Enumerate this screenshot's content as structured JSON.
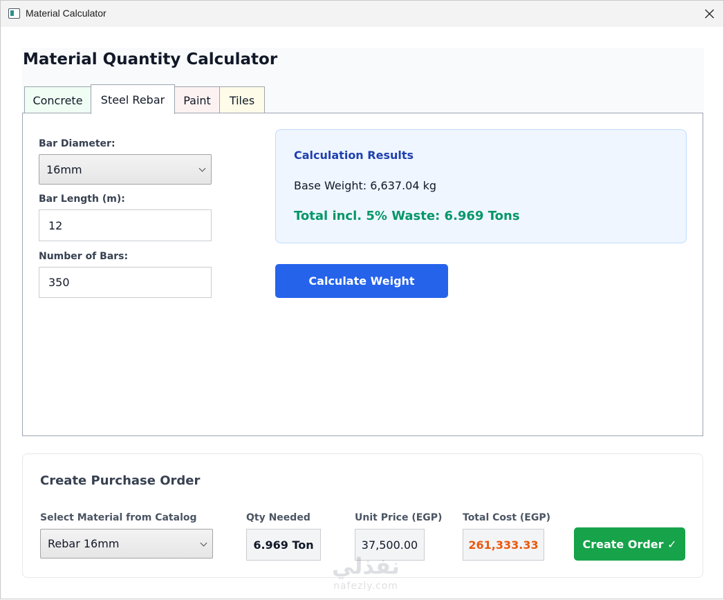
{
  "window": {
    "title": "Material Calculator",
    "app_icon": "app-window-icon",
    "close_icon": "close-icon"
  },
  "page": {
    "title": "Material Quantity Calculator"
  },
  "tabs": [
    {
      "label": "Concrete",
      "color": "#f0fdf4",
      "active": false
    },
    {
      "label": "Steel Rebar",
      "color": "#ffffff",
      "active": true
    },
    {
      "label": "Paint",
      "color": "#fdf2f2",
      "active": false
    },
    {
      "label": "Tiles",
      "color": "#fefce8",
      "active": false
    }
  ],
  "steel_rebar": {
    "diameter_label": "Bar Diameter:",
    "diameter_value": "16mm",
    "length_label": "Bar Length (m):",
    "length_value": "12",
    "count_label": "Number of Bars:",
    "count_value": "350",
    "results": {
      "title": "Calculation Results",
      "base_weight": "Base Weight: 6,637.04 kg",
      "total": "Total incl. 5% Waste: 6.969 Tons"
    },
    "calculate_label": "Calculate Weight"
  },
  "purchase_order": {
    "title": "Create Purchase Order",
    "material_label": "Select Material from Catalog",
    "material_value": "Rebar 16mm",
    "qty_label": "Qty Needed",
    "qty_value": "6.969 Ton",
    "price_label": "Unit Price (EGP)",
    "price_value": "37,500.00",
    "total_label": "Total Cost (EGP)",
    "total_value": "261,333.33",
    "create_label": "Create Order ✓"
  },
  "watermark": {
    "logo": "نفذلي",
    "text": "nafezly.com"
  },
  "colors": {
    "primary": "#2563eb",
    "success": "#16a34a",
    "results_bg": "#eff6ff",
    "results_title": "#1e40af",
    "total_text": "#059669",
    "cost_text": "#ea580c"
  }
}
